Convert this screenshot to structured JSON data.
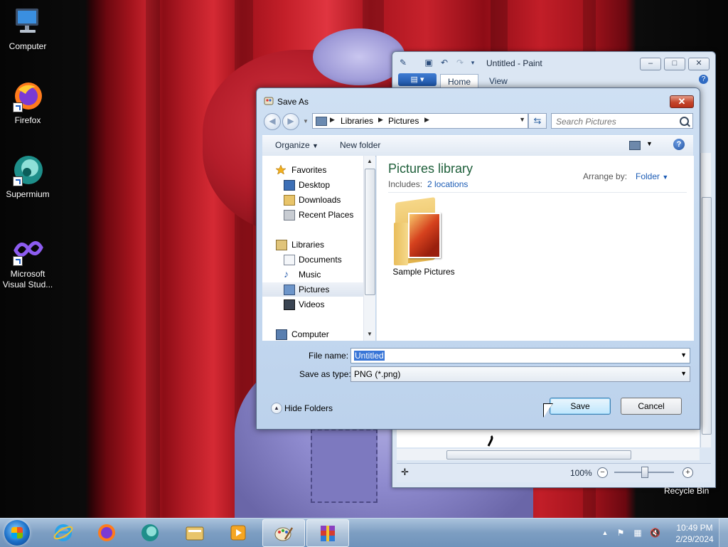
{
  "desktop": {
    "icons": [
      {
        "label": "Computer",
        "icon": "computer-icon"
      },
      {
        "label": "Firefox",
        "icon": "firefox-icon"
      },
      {
        "label": "Supermium",
        "icon": "supermium-icon"
      },
      {
        "label": "Microsoft Visual Stud...",
        "icon": "visual-studio-icon"
      }
    ],
    "recycle_bin_label": "Recycle Bin"
  },
  "paint": {
    "title": "Untitled - Paint",
    "tabs": [
      "Home",
      "View"
    ],
    "zoom": "100%"
  },
  "dialog": {
    "title": "Save As",
    "breadcrumb": [
      "Libraries",
      "Pictures"
    ],
    "search_placeholder": "Search Pictures",
    "toolbar": {
      "organize": "Organize",
      "new_folder": "New folder"
    },
    "nav": {
      "favorites": "Favorites",
      "desktop": "Desktop",
      "downloads": "Downloads",
      "recent_places": "Recent Places",
      "libraries": "Libraries",
      "documents": "Documents",
      "music": "Music",
      "pictures": "Pictures",
      "videos": "Videos",
      "computer": "Computer"
    },
    "content": {
      "library_title": "Pictures library",
      "includes_label": "Includes:",
      "locations_link": "2 locations",
      "arrange_label": "Arrange by:",
      "arrange_value": "Folder",
      "items": [
        {
          "label": "Sample Pictures",
          "icon": "folder-icon"
        }
      ]
    },
    "file_name_label": "File name:",
    "file_name_value": "Untitled",
    "save_type_label": "Save as type:",
    "save_type_value": "PNG (*.png)",
    "hide_folders": "Hide Folders",
    "save_button": "Save",
    "cancel_button": "Cancel"
  },
  "taskbar": {
    "apps": [
      "internet-explorer-icon",
      "firefox-icon",
      "supermium-icon",
      "file-explorer-icon",
      "media-player-icon",
      "paint-icon",
      "winrar-icon"
    ],
    "time": "10:49 PM",
    "date": "2/29/2024"
  },
  "colors": {
    "accent": "#3875d7",
    "library_title": "#1e5f3a",
    "link": "#1c5cb5"
  }
}
